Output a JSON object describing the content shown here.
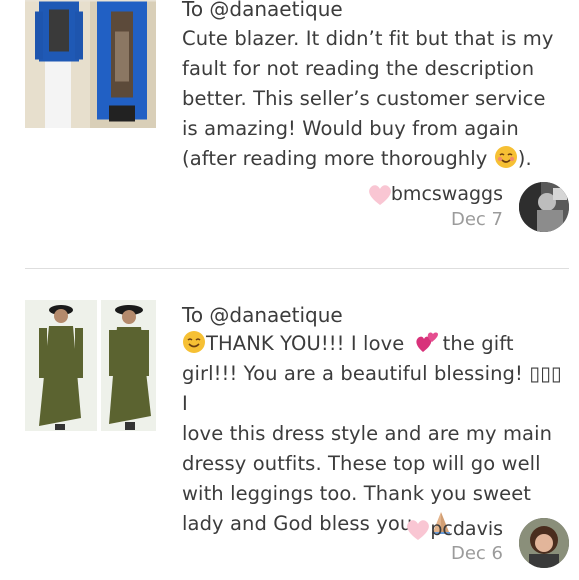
{
  "reviews": [
    {
      "to": "To @danaetique",
      "comment_lines": [
        "Cute blazer. It didn’t fit but that is my",
        "fault for not reading the description",
        "better. This seller’s customer service",
        "is amazing! Would buy from again",
        "(after reading more thoroughly"
      ],
      "comment_tail": ").",
      "emoji_end": "blushing-face-icon",
      "username": "bmcswaggs",
      "date": "Dec 7"
    },
    {
      "to": "To @danaetique",
      "comment_line1_a": "THANK YOU!!! I love",
      "comment_line1_b": "the gift",
      "comment_lines": [
        "girl!!! You are a beautiful blessing! ▯▯▯ I",
        "love this dress style and are my main",
        "dressy outfits. These top will go well",
        "with leggings too. Thank you sweet",
        "lady and God bless you."
      ],
      "username": "pcdavis",
      "date": "Dec 6"
    }
  ],
  "colors": {
    "heart": "#f9c6d3",
    "text": "#3c3c3c",
    "date": "#9b9b9b",
    "divider": "#dedede"
  }
}
